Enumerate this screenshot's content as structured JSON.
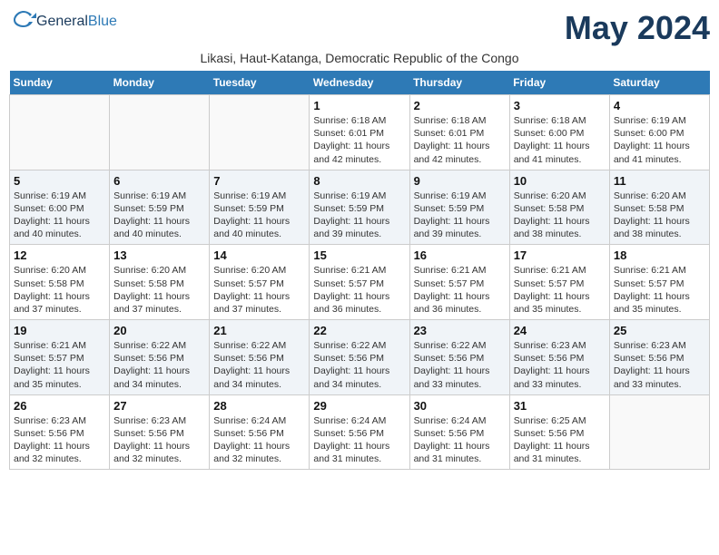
{
  "logo": {
    "general": "General",
    "blue": "Blue"
  },
  "title": "May 2024",
  "subtitle": "Likasi, Haut-Katanga, Democratic Republic of the Congo",
  "headers": [
    "Sunday",
    "Monday",
    "Tuesday",
    "Wednesday",
    "Thursday",
    "Friday",
    "Saturday"
  ],
  "weeks": [
    [
      {
        "day": "",
        "info": ""
      },
      {
        "day": "",
        "info": ""
      },
      {
        "day": "",
        "info": ""
      },
      {
        "day": "1",
        "info": "Sunrise: 6:18 AM\nSunset: 6:01 PM\nDaylight: 11 hours\nand 42 minutes."
      },
      {
        "day": "2",
        "info": "Sunrise: 6:18 AM\nSunset: 6:01 PM\nDaylight: 11 hours\nand 42 minutes."
      },
      {
        "day": "3",
        "info": "Sunrise: 6:18 AM\nSunset: 6:00 PM\nDaylight: 11 hours\nand 41 minutes."
      },
      {
        "day": "4",
        "info": "Sunrise: 6:19 AM\nSunset: 6:00 PM\nDaylight: 11 hours\nand 41 minutes."
      }
    ],
    [
      {
        "day": "5",
        "info": "Sunrise: 6:19 AM\nSunset: 6:00 PM\nDaylight: 11 hours\nand 40 minutes."
      },
      {
        "day": "6",
        "info": "Sunrise: 6:19 AM\nSunset: 5:59 PM\nDaylight: 11 hours\nand 40 minutes."
      },
      {
        "day": "7",
        "info": "Sunrise: 6:19 AM\nSunset: 5:59 PM\nDaylight: 11 hours\nand 40 minutes."
      },
      {
        "day": "8",
        "info": "Sunrise: 6:19 AM\nSunset: 5:59 PM\nDaylight: 11 hours\nand 39 minutes."
      },
      {
        "day": "9",
        "info": "Sunrise: 6:19 AM\nSunset: 5:59 PM\nDaylight: 11 hours\nand 39 minutes."
      },
      {
        "day": "10",
        "info": "Sunrise: 6:20 AM\nSunset: 5:58 PM\nDaylight: 11 hours\nand 38 minutes."
      },
      {
        "day": "11",
        "info": "Sunrise: 6:20 AM\nSunset: 5:58 PM\nDaylight: 11 hours\nand 38 minutes."
      }
    ],
    [
      {
        "day": "12",
        "info": "Sunrise: 6:20 AM\nSunset: 5:58 PM\nDaylight: 11 hours\nand 37 minutes."
      },
      {
        "day": "13",
        "info": "Sunrise: 6:20 AM\nSunset: 5:58 PM\nDaylight: 11 hours\nand 37 minutes."
      },
      {
        "day": "14",
        "info": "Sunrise: 6:20 AM\nSunset: 5:57 PM\nDaylight: 11 hours\nand 37 minutes."
      },
      {
        "day": "15",
        "info": "Sunrise: 6:21 AM\nSunset: 5:57 PM\nDaylight: 11 hours\nand 36 minutes."
      },
      {
        "day": "16",
        "info": "Sunrise: 6:21 AM\nSunset: 5:57 PM\nDaylight: 11 hours\nand 36 minutes."
      },
      {
        "day": "17",
        "info": "Sunrise: 6:21 AM\nSunset: 5:57 PM\nDaylight: 11 hours\nand 35 minutes."
      },
      {
        "day": "18",
        "info": "Sunrise: 6:21 AM\nSunset: 5:57 PM\nDaylight: 11 hours\nand 35 minutes."
      }
    ],
    [
      {
        "day": "19",
        "info": "Sunrise: 6:21 AM\nSunset: 5:57 PM\nDaylight: 11 hours\nand 35 minutes."
      },
      {
        "day": "20",
        "info": "Sunrise: 6:22 AM\nSunset: 5:56 PM\nDaylight: 11 hours\nand 34 minutes."
      },
      {
        "day": "21",
        "info": "Sunrise: 6:22 AM\nSunset: 5:56 PM\nDaylight: 11 hours\nand 34 minutes."
      },
      {
        "day": "22",
        "info": "Sunrise: 6:22 AM\nSunset: 5:56 PM\nDaylight: 11 hours\nand 34 minutes."
      },
      {
        "day": "23",
        "info": "Sunrise: 6:22 AM\nSunset: 5:56 PM\nDaylight: 11 hours\nand 33 minutes."
      },
      {
        "day": "24",
        "info": "Sunrise: 6:23 AM\nSunset: 5:56 PM\nDaylight: 11 hours\nand 33 minutes."
      },
      {
        "day": "25",
        "info": "Sunrise: 6:23 AM\nSunset: 5:56 PM\nDaylight: 11 hours\nand 33 minutes."
      }
    ],
    [
      {
        "day": "26",
        "info": "Sunrise: 6:23 AM\nSunset: 5:56 PM\nDaylight: 11 hours\nand 32 minutes."
      },
      {
        "day": "27",
        "info": "Sunrise: 6:23 AM\nSunset: 5:56 PM\nDaylight: 11 hours\nand 32 minutes."
      },
      {
        "day": "28",
        "info": "Sunrise: 6:24 AM\nSunset: 5:56 PM\nDaylight: 11 hours\nand 32 minutes."
      },
      {
        "day": "29",
        "info": "Sunrise: 6:24 AM\nSunset: 5:56 PM\nDaylight: 11 hours\nand 31 minutes."
      },
      {
        "day": "30",
        "info": "Sunrise: 6:24 AM\nSunset: 5:56 PM\nDaylight: 11 hours\nand 31 minutes."
      },
      {
        "day": "31",
        "info": "Sunrise: 6:25 AM\nSunset: 5:56 PM\nDaylight: 11 hours\nand 31 minutes."
      },
      {
        "day": "",
        "info": ""
      }
    ]
  ]
}
